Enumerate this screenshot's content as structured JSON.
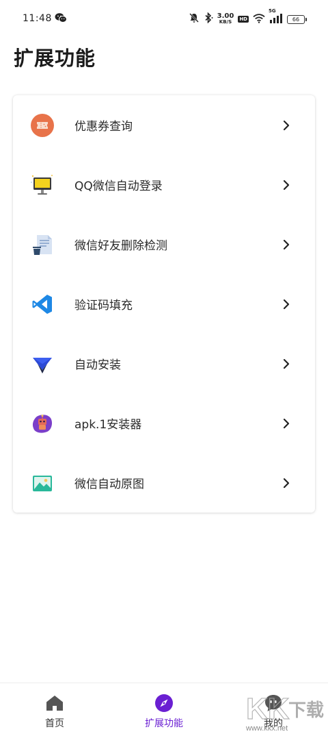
{
  "status_bar": {
    "time": "11:48",
    "net_speed_value": "3.00",
    "net_speed_unit": "KB/S",
    "hd_label": "HD",
    "signal_label": "5G",
    "battery_level": "66"
  },
  "page": {
    "title": "扩展功能"
  },
  "menu": {
    "items": [
      {
        "label": "优惠券查询",
        "icon": "coupon-icon"
      },
      {
        "label": "QQ微信自动登录",
        "icon": "monitor-icon"
      },
      {
        "label": "微信好友删除检测",
        "icon": "document-trash-icon"
      },
      {
        "label": "验证码填充",
        "icon": "code-editor-icon"
      },
      {
        "label": "自动安装",
        "icon": "triangle-install-icon"
      },
      {
        "label": "apk.1安装器",
        "icon": "robot-icon"
      },
      {
        "label": "微信自动原图",
        "icon": "image-icon"
      }
    ]
  },
  "bottom_nav": {
    "items": [
      {
        "label": "首页",
        "icon": "home-icon"
      },
      {
        "label": "扩展功能",
        "icon": "compass-icon",
        "active": true
      },
      {
        "label": "我的",
        "icon": "chat-bubble-icon"
      }
    ]
  },
  "watermark": {
    "brand": "KK下载",
    "url": "www.kkx.net"
  },
  "colors": {
    "accent": "#6a1fd2",
    "coupon": "#e8734a",
    "vscode_blue": "#1e88e5"
  }
}
